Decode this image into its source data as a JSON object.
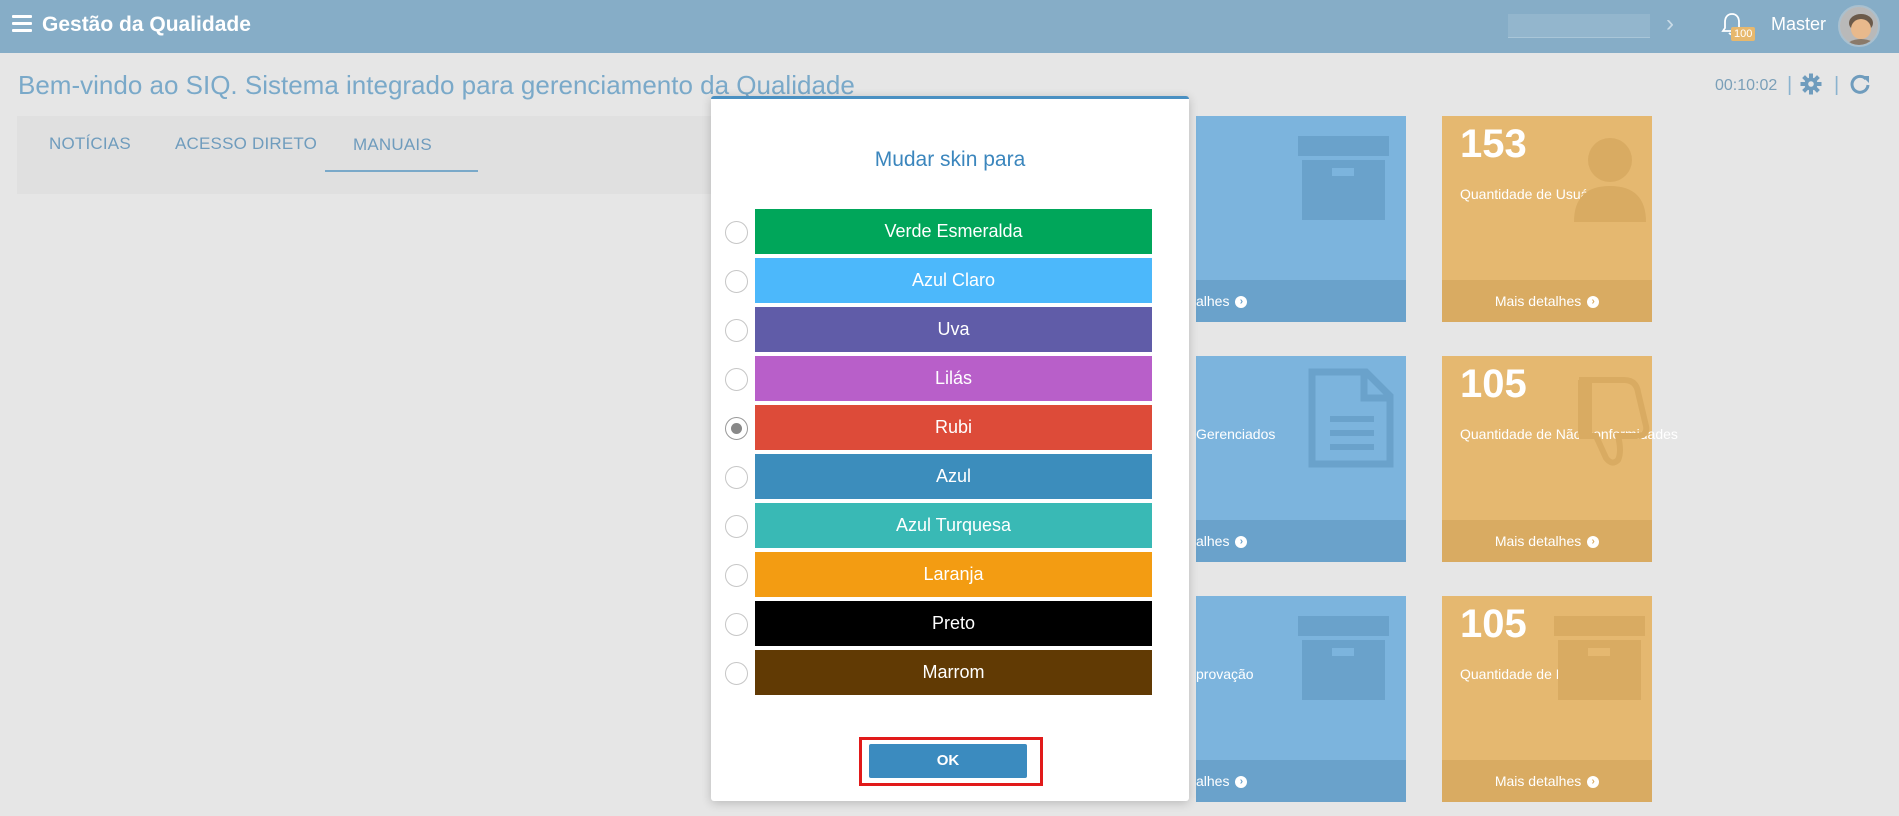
{
  "header": {
    "app_title": "Gestão da Qualidade",
    "notification_count": "100",
    "user_name": "Master"
  },
  "page": {
    "title": "Bem-vindo ao SIQ. Sistema integrado para gerenciamento da Qualidade",
    "clock": "00:10:02",
    "separator": "|"
  },
  "tabs": [
    {
      "label": "NOTÍCIAS"
    },
    {
      "label": "ACESSO DIRETO"
    },
    {
      "label": "MANUAIS",
      "active": true
    }
  ],
  "tiles": {
    "blue_1": {
      "footer": "alhes"
    },
    "blue_2": {
      "label": "Gerenciados",
      "footer": "alhes"
    },
    "blue_3": {
      "label": "provação",
      "footer": "alhes"
    },
    "orange_1": {
      "count": "153",
      "label": "Quantidade de Usuários",
      "footer": "Mais detalhes"
    },
    "orange_2": {
      "count": "105",
      "label": "Quantidade de Não-conformidades",
      "footer": "Mais detalhes"
    },
    "orange_3": {
      "count": "105",
      "label": "Quantidade de Desvio",
      "footer": "Mais detalhes"
    }
  },
  "modal": {
    "title": "Mudar skin para",
    "ok_label": "OK",
    "selected": "Rubi",
    "skins": [
      {
        "label": "Verde Esmeralda",
        "color": "#00a65a"
      },
      {
        "label": "Azul Claro",
        "color": "#4cb8fb"
      },
      {
        "label": "Uva",
        "color": "#605ca8"
      },
      {
        "label": "Lilás",
        "color": "#b85fc9"
      },
      {
        "label": "Rubi",
        "color": "#dd4b39"
      },
      {
        "label": "Azul",
        "color": "#3c8dbc"
      },
      {
        "label": "Azul Turquesa",
        "color": "#39b9b5"
      },
      {
        "label": "Laranja",
        "color": "#f39c12"
      },
      {
        "label": "Preto",
        "color": "#000000"
      },
      {
        "label": "Marrom",
        "color": "#613a04"
      }
    ]
  },
  "colors": {
    "topbar": "#86adc7",
    "accent": "#3b86bd",
    "highlight": "#e11a1a"
  }
}
